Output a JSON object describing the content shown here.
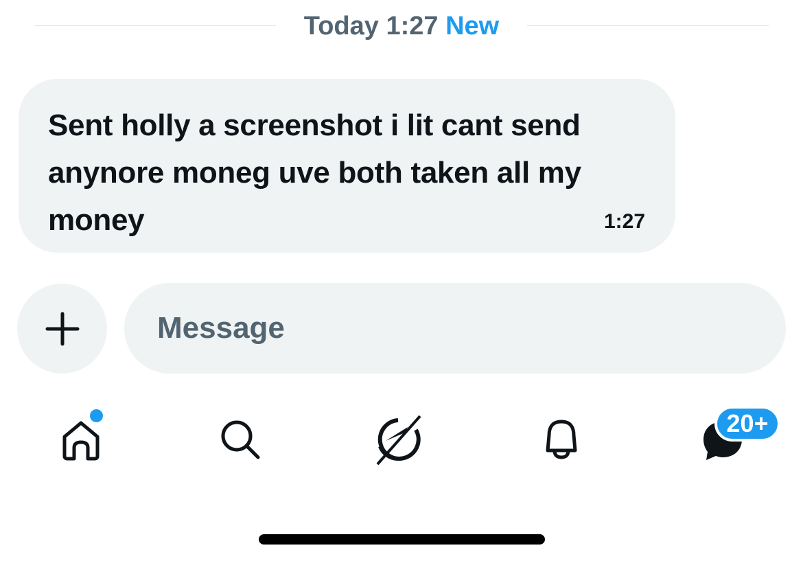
{
  "divider": {
    "day_time": "Today 1:27",
    "new_label": "New"
  },
  "message": {
    "text": "Sent holly a screenshot i lit cant send anynore moneg uve both taken all my money",
    "time": "1:27"
  },
  "composer": {
    "add_icon": "plus-icon",
    "placeholder": "Message"
  },
  "nav": {
    "items": [
      {
        "icon": "home-icon",
        "has_dot": true
      },
      {
        "icon": "search-icon"
      },
      {
        "icon": "grok-icon"
      },
      {
        "icon": "bell-icon"
      },
      {
        "icon": "messages-icon",
        "badge": "20+"
      }
    ]
  },
  "colors": {
    "accent": "#1d9bf0",
    "bubble_bg": "#eff3f4",
    "secondary_text": "#536471",
    "primary_text": "#0f1419"
  }
}
